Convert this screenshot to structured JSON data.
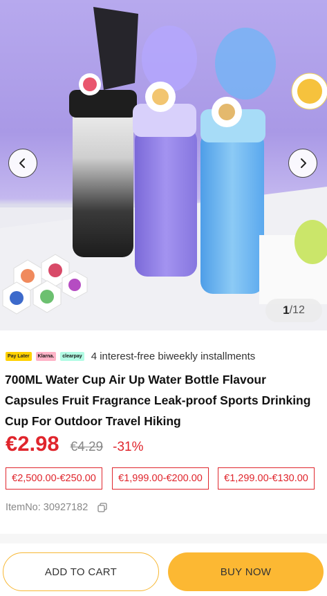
{
  "gallery": {
    "current_page": "1",
    "page_total": "/12"
  },
  "payment": {
    "badges": [
      "Pay Later",
      "Klarna.",
      "clearpay"
    ],
    "installments_text": "4 interest-free biweekly installments"
  },
  "product": {
    "title": "700ML Water Cup Air Up Water Bottle Flavour Capsules Fruit Fragrance Leak-proof Sports Drinking Cup For Outdoor Travel Hiking",
    "price": "€2.98",
    "original_price": "€4.29",
    "discount": "-31%",
    "price_tiers": [
      "€2,500.00-€250.00",
      "€1,999.00-€200.00",
      "€1,299.00-€130.00"
    ],
    "item_no": "ItemNo: 30927182"
  },
  "actions": {
    "add_to_cart": "ADD TO CART",
    "buy_now": "BUY NOW"
  },
  "colors": {
    "price_red": "#e0252c",
    "buy_button": "#fcb833",
    "cart_border": "#f7b733"
  },
  "icons": [
    "chevron-left-icon",
    "chevron-right-icon",
    "copy-icon"
  ]
}
